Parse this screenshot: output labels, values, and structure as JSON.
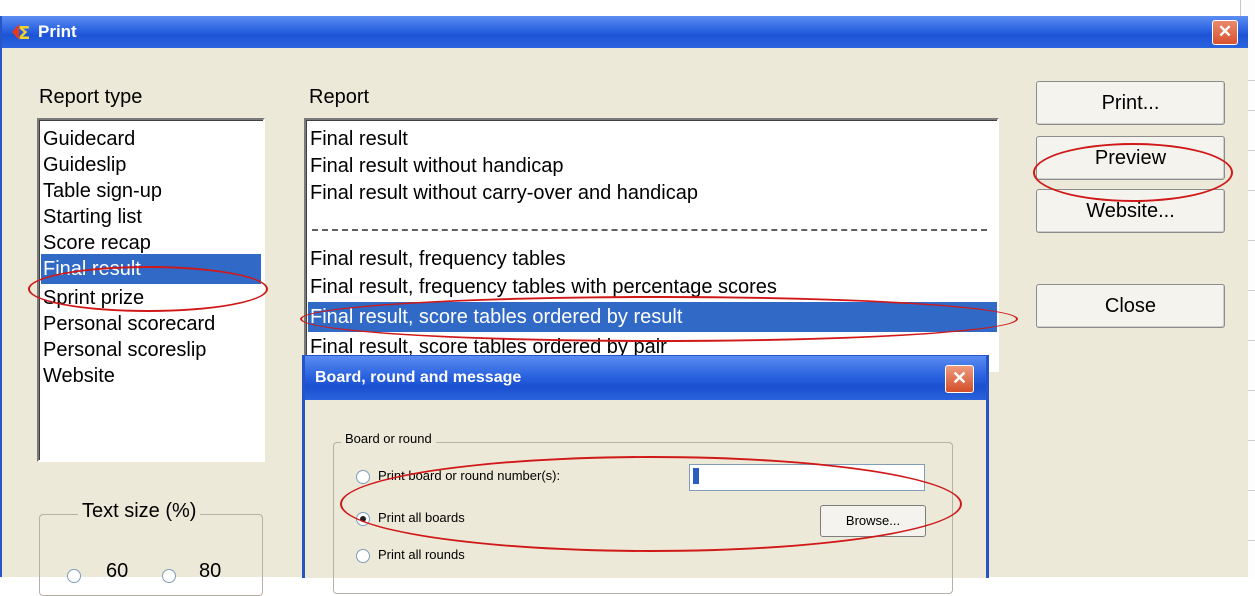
{
  "window": {
    "title": "Print",
    "icon": "sigma-app-icon",
    "close_label": "✕"
  },
  "report_type": {
    "label": "Report type",
    "items": [
      "Guidecard",
      "Guideslip",
      "Table sign-up",
      "Starting list",
      "Score recap",
      "Final result",
      "Sprint prize",
      "Personal scorecard",
      "Personal scoreslip",
      "Website"
    ],
    "selected": "Final result"
  },
  "report": {
    "label": "Report",
    "items": [
      "Final result",
      "Final result without handicap",
      "Final result without carry-over and handicap",
      "Final result, frequency tables",
      "Final result, frequency tables with percentage scores",
      "Final result, score tables ordered by result",
      "Final result, score tables ordered by pair"
    ],
    "selected": "Final result, score tables ordered by result"
  },
  "buttons": {
    "print": "Print...",
    "preview": "Preview",
    "website": "Website...",
    "close": "Close"
  },
  "text_size": {
    "label": "Text size (%)",
    "options": [
      "60",
      "80"
    ]
  },
  "sub_dialog": {
    "title": "Board, round and message",
    "close_label": "✕",
    "group_label": "Board or round",
    "option_numbers": "Print board or round number(s):",
    "option_all_boards": "Print all boards",
    "option_all_rounds": "Print all rounds",
    "numbers_value": "",
    "browse": "Browse..."
  },
  "colors": {
    "selection": "#3169c6",
    "titlebar": "#2a62e2",
    "dialog_bg": "#ece9d8",
    "annotation": "#d01818"
  }
}
